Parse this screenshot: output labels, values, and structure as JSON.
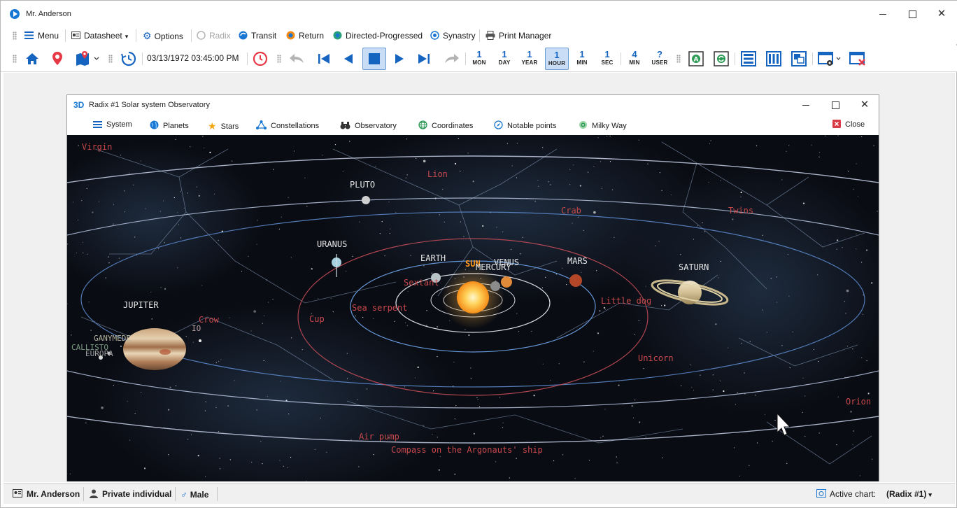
{
  "window": {
    "title": "Mr. Anderson"
  },
  "menubar": {
    "menu": "Menu",
    "datasheet": "Datasheet",
    "options": "Options",
    "radix": "Radix",
    "transit": "Transit",
    "return": "Return",
    "directed": "Directed-Progressed",
    "synastry": "Synastry",
    "print_manager": "Print Manager"
  },
  "toolbar": {
    "datetime": "03/13/1972 03:45:00 PM",
    "steps": [
      {
        "num": "1",
        "label": "MON"
      },
      {
        "num": "1",
        "label": "DAY"
      },
      {
        "num": "1",
        "label": "YEAR"
      },
      {
        "num": "1",
        "label": "HOUR"
      },
      {
        "num": "1",
        "label": "MIN"
      },
      {
        "num": "1",
        "label": "SEC"
      },
      {
        "num": "4",
        "label": "MIN"
      },
      {
        "num": "?",
        "label": "USER"
      }
    ]
  },
  "child_window": {
    "badge": "3D",
    "title": "Radix #1 Solar system Observatory",
    "menu": {
      "system": "System",
      "planets": "Planets",
      "stars": "Stars",
      "constellations": "Constellations",
      "observatory": "Observatory",
      "coordinates": "Coordinates",
      "notable_points": "Notable points",
      "milky_way": "Milky Way",
      "close": "Close"
    }
  },
  "scene": {
    "planets": {
      "pluto": "PLUTO",
      "uranus": "URANUS",
      "earth": "EARTH",
      "sun": "SUN",
      "venus": "VENUS",
      "mercury": "MERCURY",
      "mars": "MARS",
      "saturn": "SATURN",
      "jupiter": "JUPITER",
      "ganymede": "GANYMEDE",
      "callisto": "CALLISTO",
      "europa": "EUROPA",
      "io": "IO"
    },
    "constellations": {
      "virgin": "Virgin",
      "lion": "Lion",
      "crab": "Crab",
      "twins": "Twins",
      "sextant": "Sextant",
      "sea_serpent": "Sea serpent",
      "cup": "Cup",
      "crow": "Crow",
      "little_dog": "Little dog",
      "unicorn": "Unicorn",
      "orion": "Orion",
      "air_pump": "Air pump",
      "compass": "Compass on the Argonauts' ship"
    },
    "colors": {
      "label_planet": "#e8e8e8",
      "label_sun": "#ff9a1f",
      "label_const": "#c8494d",
      "sky": "#0b0d14"
    }
  },
  "statusbar": {
    "user": "Mr. Anderson",
    "type": "Private individual",
    "gender": "Male",
    "active_label": "Active chart:",
    "active_value": "(Radix #1)"
  }
}
